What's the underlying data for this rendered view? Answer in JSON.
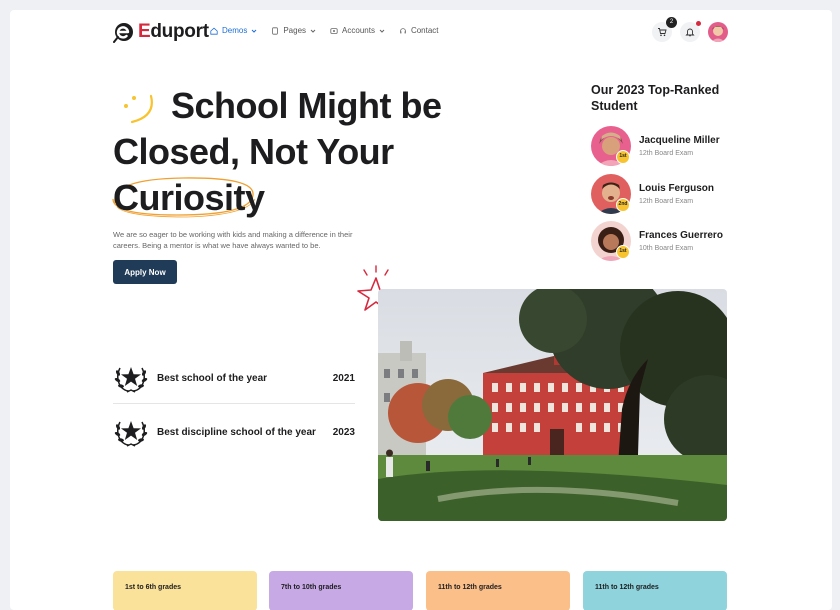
{
  "brand": {
    "first_letter": "E",
    "rest": "duport"
  },
  "nav": [
    {
      "label": "Demos",
      "icon": "home-icon",
      "active": true
    },
    {
      "label": "Pages",
      "icon": "page-icon",
      "active": false
    },
    {
      "label": "Accounts",
      "icon": "account-icon",
      "active": false
    },
    {
      "label": "Contact",
      "icon": "headset-icon",
      "active": false
    }
  ],
  "header": {
    "cart_count": "2"
  },
  "hero": {
    "line1": "School Might be",
    "line2": "Closed, Not Your",
    "line3": "Curiosity",
    "description": "We are so eager to be working with kids and making a difference in their careers. Being a mentor is what we have always wanted to be.",
    "cta": "Apply Now"
  },
  "top_students": {
    "title": "Our 2023 Top-Ranked Student",
    "items": [
      {
        "name": "Jacqueline Miller",
        "exam": "12th Board Exam",
        "rank": "1st"
      },
      {
        "name": "Louis Ferguson",
        "exam": "12th Board Exam",
        "rank": "2nd"
      },
      {
        "name": "Frances Guerrero",
        "exam": "10th Board Exam",
        "rank": "1st"
      }
    ]
  },
  "awards": [
    {
      "label": "Best school of the year",
      "year": "2021"
    },
    {
      "label": "Best discipline school of the year",
      "year": "2023"
    }
  ],
  "grades": [
    {
      "label": "1st to 6th grades",
      "color": "#fbe29a"
    },
    {
      "label": "7th to 10th grades",
      "color": "#c7a9e6"
    },
    {
      "label": "11th to 12th grades",
      "color": "#fbbf8a"
    },
    {
      "label": "11th to 12th grades",
      "color": "#8fd3dc"
    }
  ],
  "colors": {
    "accent": "#1d6fd6",
    "brand_red": "#d6293e",
    "button": "#1f3b57",
    "highlight": "#f0a030"
  }
}
